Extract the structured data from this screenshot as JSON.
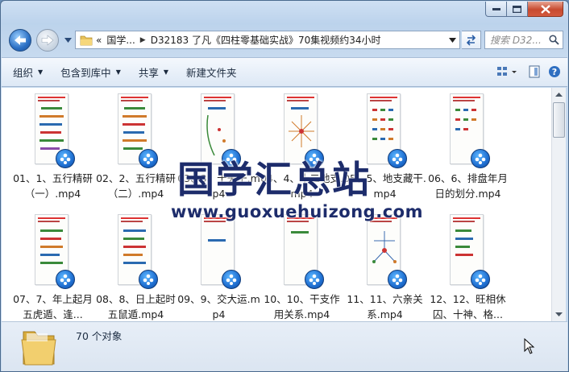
{
  "window": {
    "caption": {
      "minimize": "minimize",
      "maximize": "maximize",
      "close": "close"
    }
  },
  "address": {
    "chevron": "«",
    "crumb1": "国学...",
    "crumb2": "D32183 了凡《四柱零基础实战》70集视频约34小时",
    "search_placeholder": "搜索 D32..."
  },
  "toolbar": {
    "organize": "组织",
    "include_library": "包含到库中",
    "share": "共享",
    "new_folder": "新建文件夹"
  },
  "files": [
    {
      "name": "01、1、五行精研（一）.mp4"
    },
    {
      "name": "02、2、五行精研（二）.mp4"
    },
    {
      "name": "03、3、十天干.mp4"
    },
    {
      "name": "04、4、十二地支.mp4"
    },
    {
      "name": "05、5、地支藏干.mp4"
    },
    {
      "name": "06、6、排盘年月日的划分.mp4"
    },
    {
      "name": "07、7、年上起月五虎遁、逢..."
    },
    {
      "name": "08、8、日上起时五鼠遁.mp4"
    },
    {
      "name": "09、9、交大运.mp4"
    },
    {
      "name": "10、10、干支作用关系.mp4"
    },
    {
      "name": "11、11、六亲关系.mp4"
    },
    {
      "name": "12、12、旺相休囚、十神、格..."
    }
  ],
  "watermark": {
    "title": "国学汇总站",
    "url": "www.guoxuehuizong.com"
  },
  "status": {
    "count": "70 个对象"
  },
  "colors": {
    "accent": "#1f6fd1",
    "watermark": "#1d2c6b",
    "close": "#c74a2f"
  }
}
